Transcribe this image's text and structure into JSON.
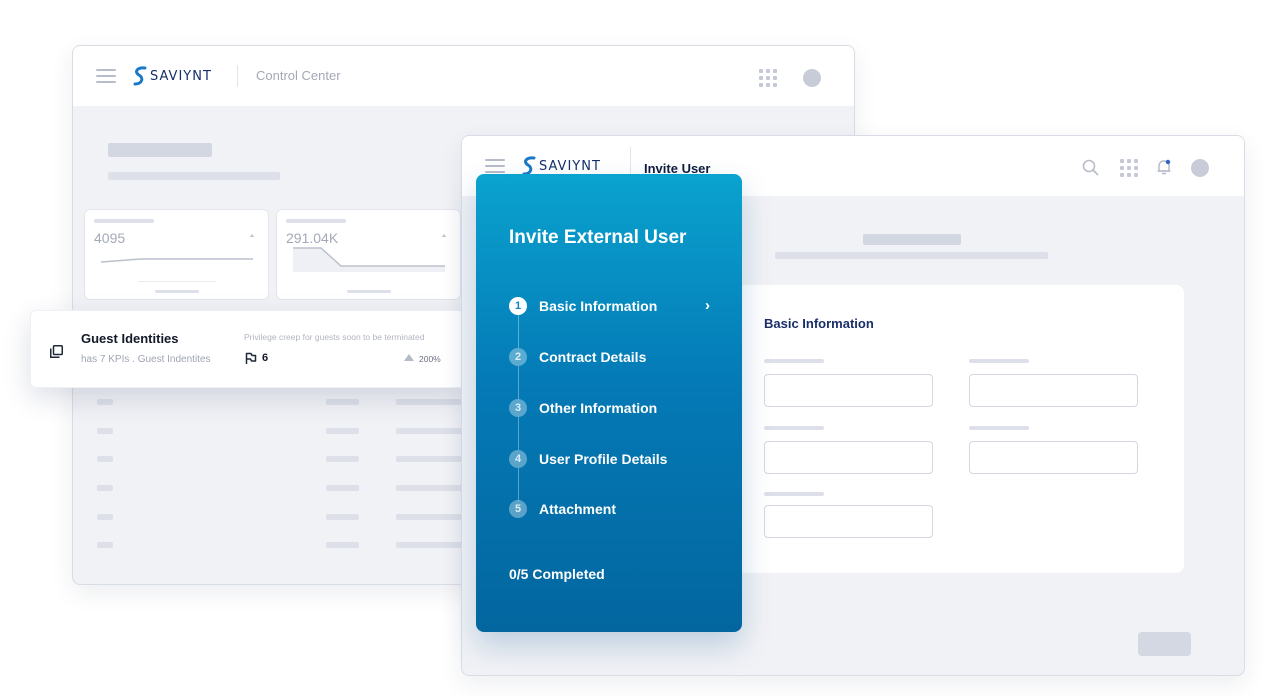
{
  "back_window": {
    "brand": "SAVIYNT",
    "title": "Control Center",
    "kpis": [
      {
        "value": "4095"
      },
      {
        "value": "291.04K"
      }
    ]
  },
  "guest_card": {
    "title": "Guest Identities",
    "subtitle": "has 7 KPIs . Guest Indentites",
    "note": "Privilege creep for guests soon to be terminated",
    "count": "6",
    "change": "200%"
  },
  "front_window": {
    "brand": "SAVIYNT",
    "title": "Invite User"
  },
  "stepper": {
    "title": "Invite External User",
    "steps": [
      {
        "num": "1",
        "label": "Basic Information"
      },
      {
        "num": "2",
        "label": "Contract Details"
      },
      {
        "num": "3",
        "label": "Other Information"
      },
      {
        "num": "4",
        "label": "User Profile Details"
      },
      {
        "num": "5",
        "label": "Attachment"
      }
    ],
    "progress": "0/5 Completed"
  },
  "form": {
    "section_title": "Basic Information"
  },
  "colors": {
    "brand_navy": "#16306d",
    "stepper_top": "#0aa3cf",
    "stepper_bottom": "#03669f"
  }
}
